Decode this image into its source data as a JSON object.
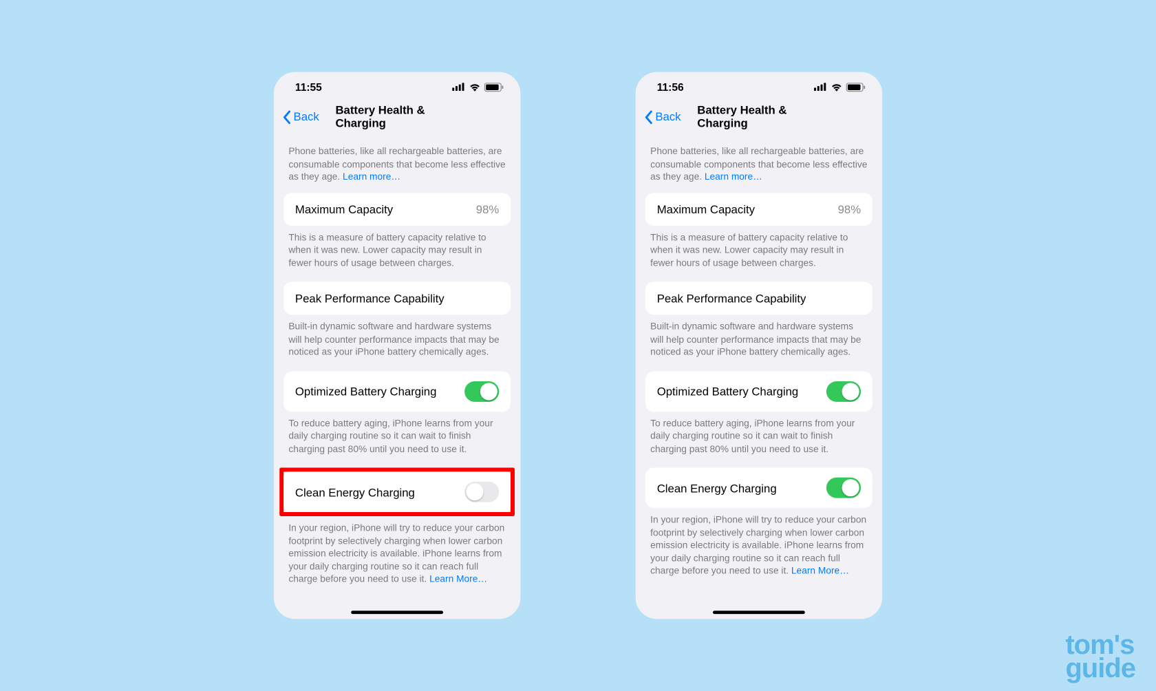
{
  "watermark": {
    "line1": "tom's",
    "line2": "guide"
  },
  "phones": [
    {
      "time": "11:55",
      "back": "Back",
      "title": "Battery Health & Charging",
      "intro": "Phone batteries, like all rechargeable batteries, are consumable components that become less effective as they age. ",
      "intro_link": "Learn more…",
      "max_capacity": {
        "label": "Maximum Capacity",
        "value": "98%"
      },
      "max_desc": "This is a measure of battery capacity relative to when it was new. Lower capacity may result in fewer hours of usage between charges.",
      "peak": {
        "label": "Peak Performance Capability"
      },
      "peak_desc": "Built-in dynamic software and hardware systems will help counter performance impacts that may be noticed as your iPhone battery chemically ages.",
      "optimized": {
        "label": "Optimized Battery Charging",
        "on": true
      },
      "optimized_desc": "To reduce battery aging, iPhone learns from your daily charging routine so it can wait to finish charging past 80% until you need to use it.",
      "clean": {
        "label": "Clean Energy Charging",
        "on": false,
        "highlighted": true
      },
      "clean_desc": "In your region, iPhone will try to reduce your carbon footprint by selectively charging when lower carbon emission electricity is available. iPhone learns from your daily charging routine so it can reach full charge before you need to use it. ",
      "clean_link": "Learn More…"
    },
    {
      "time": "11:56",
      "back": "Back",
      "title": "Battery Health & Charging",
      "intro": "Phone batteries, like all rechargeable batteries, are consumable components that become less effective as they age. ",
      "intro_link": "Learn more…",
      "max_capacity": {
        "label": "Maximum Capacity",
        "value": "98%"
      },
      "max_desc": "This is a measure of battery capacity relative to when it was new. Lower capacity may result in fewer hours of usage between charges.",
      "peak": {
        "label": "Peak Performance Capability"
      },
      "peak_desc": "Built-in dynamic software and hardware systems will help counter performance impacts that may be noticed as your iPhone battery chemically ages.",
      "optimized": {
        "label": "Optimized Battery Charging",
        "on": true
      },
      "optimized_desc": "To reduce battery aging, iPhone learns from your daily charging routine so it can wait to finish charging past 80% until you need to use it.",
      "clean": {
        "label": "Clean Energy Charging",
        "on": true,
        "highlighted": false
      },
      "clean_desc": "In your region, iPhone will try to reduce your carbon footprint by selectively charging when lower carbon emission electricity is available. iPhone learns from your daily charging routine so it can reach full charge before you need to use it. ",
      "clean_link": "Learn More…"
    }
  ]
}
